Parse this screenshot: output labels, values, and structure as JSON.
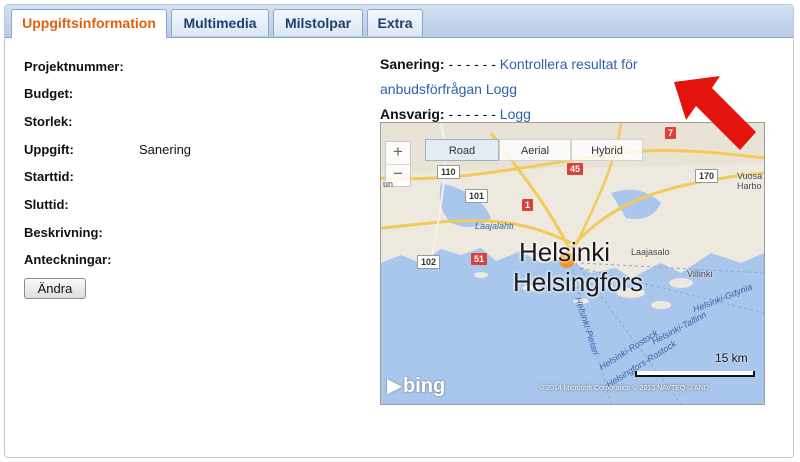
{
  "tabs": [
    {
      "label": "Uppgiftsinformation",
      "active": true
    },
    {
      "label": "Multimedia",
      "active": false
    },
    {
      "label": "Milstolpar",
      "active": false
    },
    {
      "label": "Extra",
      "active": false
    }
  ],
  "fields": {
    "projektnummer": {
      "label": "Projektnummer:",
      "value": ""
    },
    "budget": {
      "label": "Budget:",
      "value": ""
    },
    "storlek": {
      "label": "Storlek:",
      "value": ""
    },
    "uppgift": {
      "label": "Uppgift:",
      "value": "Sanering"
    },
    "starttid": {
      "label": "Starttid:",
      "value": ""
    },
    "sluttid": {
      "label": "Sluttid:",
      "value": ""
    },
    "beskrivning": {
      "label": "Beskrivning:",
      "value": ""
    },
    "anteckningar": {
      "label": "Anteckningar:",
      "value": ""
    }
  },
  "edit_button": "Ändra",
  "sanering": {
    "label": "Sanering:",
    "dashes": " - - - - - - ",
    "link_line1": "Kontrollera resultat för",
    "link_line2": "anbudsförfrågan Logg"
  },
  "ansvarig": {
    "label": "Ansvarig:",
    "dashes": " - - - - - - ",
    "link": "Logg"
  },
  "map": {
    "zoom_in": "+",
    "zoom_out": "−",
    "map_types": [
      "Road",
      "Aerial",
      "Hybrid"
    ],
    "selected_map_type": "Road",
    "city_name": "Helsinki",
    "city_name_swedish": "Helsingfors",
    "places": [
      "Laajasalo",
      "Villinki",
      "Vuosa",
      "Harbo",
      "un"
    ],
    "water": [
      "Laajalahti",
      "Helsinki-Gdynia",
      "Helsinki-Tallinn",
      "Helsinki-Rostock",
      "Helsingfors-Rostock",
      "Helsinki-Pietari"
    ],
    "routes": {
      "r110": "110",
      "r101": "101",
      "r1": "1",
      "r102": "102",
      "r51": "51",
      "r45": "45",
      "r7": "7",
      "r170": "170"
    },
    "scale_label": "15 km",
    "logo": "bing",
    "copyright": "© 2014 Microsoft Corporation   © 2010 NAVTEQ   © AND"
  },
  "colors": {
    "active_tab_text": "#e06010",
    "link": "#2f5fb0",
    "annotation_arrow": "#e3140c",
    "map_water": "#a9c7ec",
    "map_land": "#eee9df",
    "map_marker": "#f5941e"
  }
}
